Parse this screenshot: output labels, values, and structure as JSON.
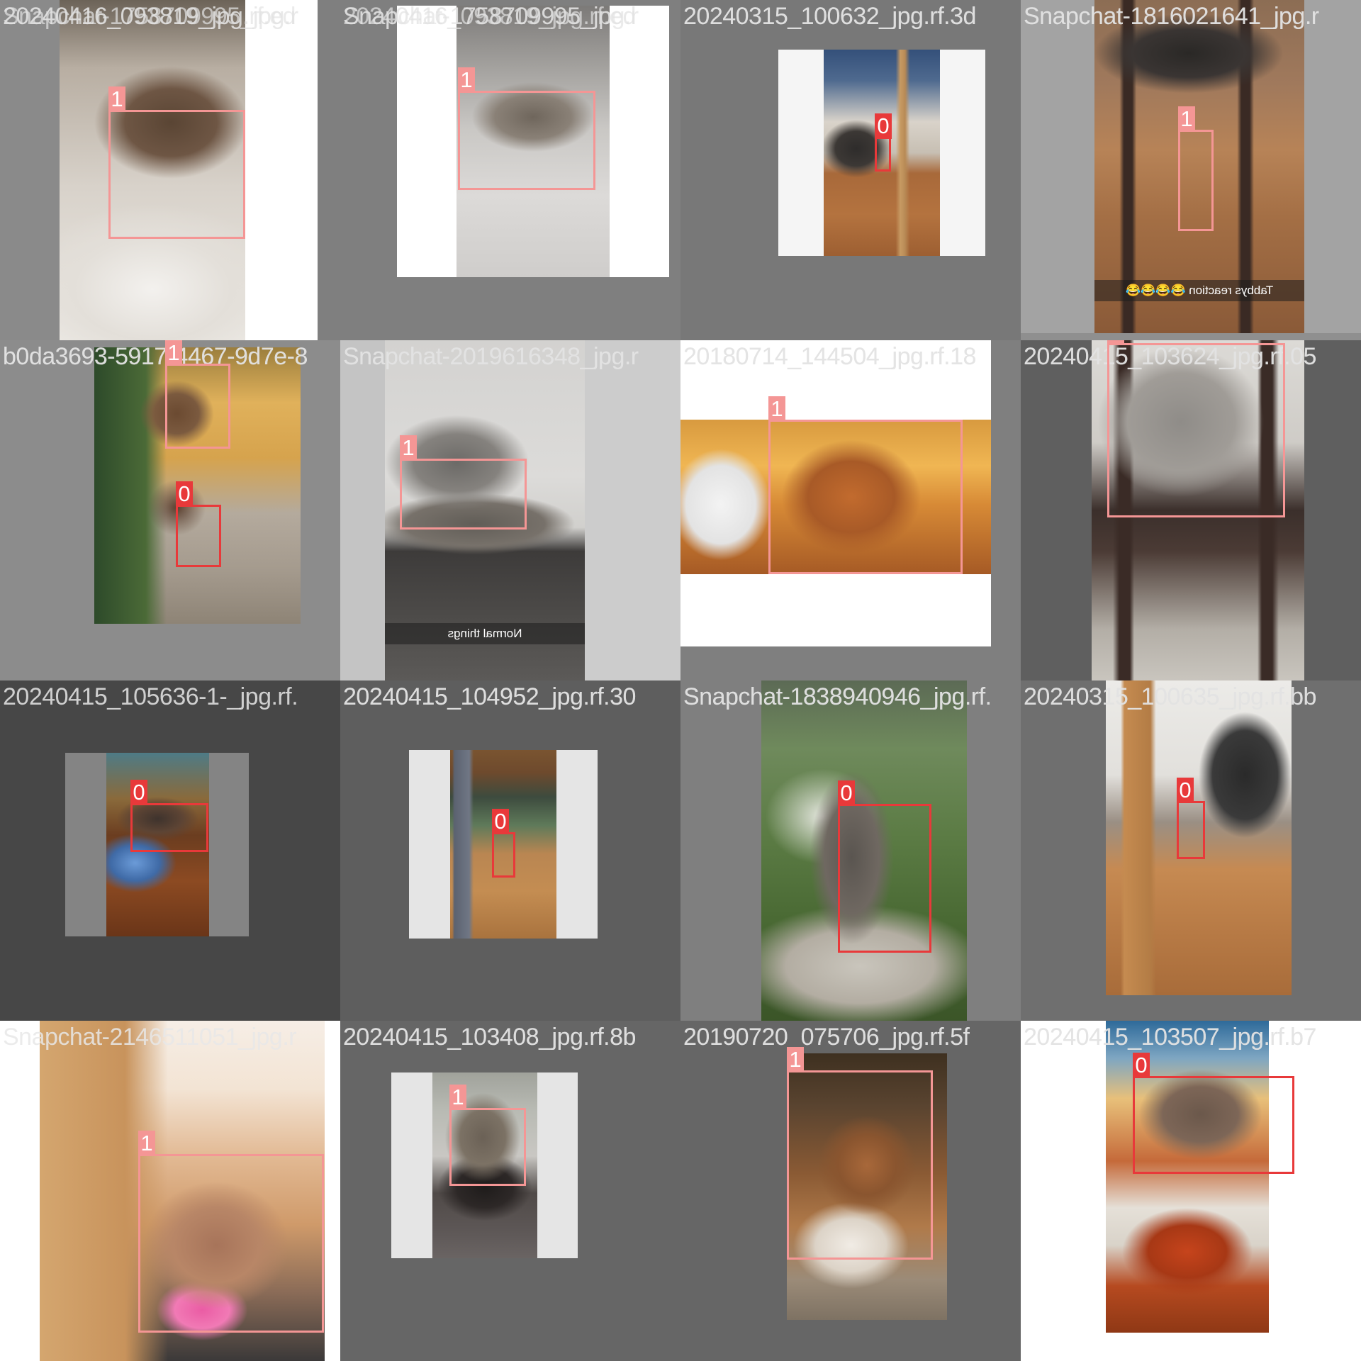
{
  "colors": {
    "class_0": "#e8393a",
    "class_1": "#f49695"
  },
  "tiles": [
    {
      "filenames": [
        "20240416_093819_jpg.rf.ed",
        "Snapchat-1758709995_jpg.r"
      ],
      "caption": "",
      "boxes": [
        {
          "label": "1",
          "class": 1
        }
      ]
    },
    {
      "filenames": [
        "Snapchat-1758709995_jpg.r",
        "20240416_093819_jpg.rf.ed"
      ],
      "caption": "",
      "boxes": [
        {
          "label": "1",
          "class": 1
        }
      ]
    },
    {
      "filenames": [
        "20240315_100632_jpg.rf.3d",
        "20240315_100632_jpg.rf.3d"
      ],
      "caption": "",
      "boxes": [
        {
          "label": "0",
          "class": 0
        }
      ]
    },
    {
      "filenames": [
        "Snapchat-1816021641_jpg.r",
        "Snapchat-1816021641_jpg.r"
      ],
      "caption": "Tabbys reaction 😂😂😂😂",
      "boxes": [
        {
          "label": "1",
          "class": 1
        }
      ]
    },
    {
      "filenames": [
        "b0da3693-5917-4467-9d7e-8",
        "b0da3693-5917-4467-9d7e-8"
      ],
      "caption": "",
      "boxes": [
        {
          "label": "1",
          "class": 1
        },
        {
          "label": "0",
          "class": 0
        }
      ]
    },
    {
      "filenames": [
        "Snapchat-2019616348_jpg.r",
        "Snapchat-2019616348_jpg.r"
      ],
      "caption": "Normal things",
      "boxes": [
        {
          "label": "1",
          "class": 1
        }
      ]
    },
    {
      "filenames": [
        "20180714_144504_jpg.rf.18",
        "20180714_144504_jpg.rf.18"
      ],
      "caption": "",
      "boxes": [
        {
          "label": "1",
          "class": 1
        }
      ]
    },
    {
      "filenames": [
        "20240415_103624_jpg.rf.05",
        "20240415_103624_jpg.rf.05"
      ],
      "caption": "",
      "boxes": [
        {
          "label": "1",
          "class": 1
        }
      ]
    },
    {
      "filenames": [
        "20240415_105636-1-_jpg.rf.",
        ""
      ],
      "caption": "",
      "boxes": [
        {
          "label": "0",
          "class": 0
        }
      ]
    },
    {
      "filenames": [
        "20240415_104952_jpg.rf.30",
        "20240415_104952_jpg.rf.30"
      ],
      "caption": "",
      "boxes": [
        {
          "label": "0",
          "class": 0
        }
      ]
    },
    {
      "filenames": [
        "Snapchat-1838940946_jpg.rf.",
        "Snapchat-1838940946_jpg.rf."
      ],
      "caption": "",
      "boxes": [
        {
          "label": "0",
          "class": 0
        }
      ]
    },
    {
      "filenames": [
        "20240315_100635_jpg.rf.bb",
        "20240315_100635_jpg.rf.bb"
      ],
      "caption": "",
      "boxes": [
        {
          "label": "0",
          "class": 0
        }
      ]
    },
    {
      "filenames": [
        "Snapchat-2146511051_jpg.r",
        ""
      ],
      "caption": "",
      "boxes": [
        {
          "label": "1",
          "class": 1
        }
      ]
    },
    {
      "filenames": [
        "20240415_103408_jpg.rf.8b",
        "20240415_103408_jpg.rf.8b"
      ],
      "caption": "",
      "boxes": [
        {
          "label": "1",
          "class": 1
        }
      ]
    },
    {
      "filenames": [
        "20190720_075706_jpg.rf.5f",
        "20190720_075706_jpg.rf.5f"
      ],
      "caption": "",
      "boxes": [
        {
          "label": "1",
          "class": 1
        }
      ]
    },
    {
      "filenames": [
        "20240415_103507_jpg.rf.b7",
        "20240415_103507_jpg.rf.b7"
      ],
      "caption": "",
      "boxes": [
        {
          "label": "0",
          "class": 0
        }
      ]
    }
  ]
}
